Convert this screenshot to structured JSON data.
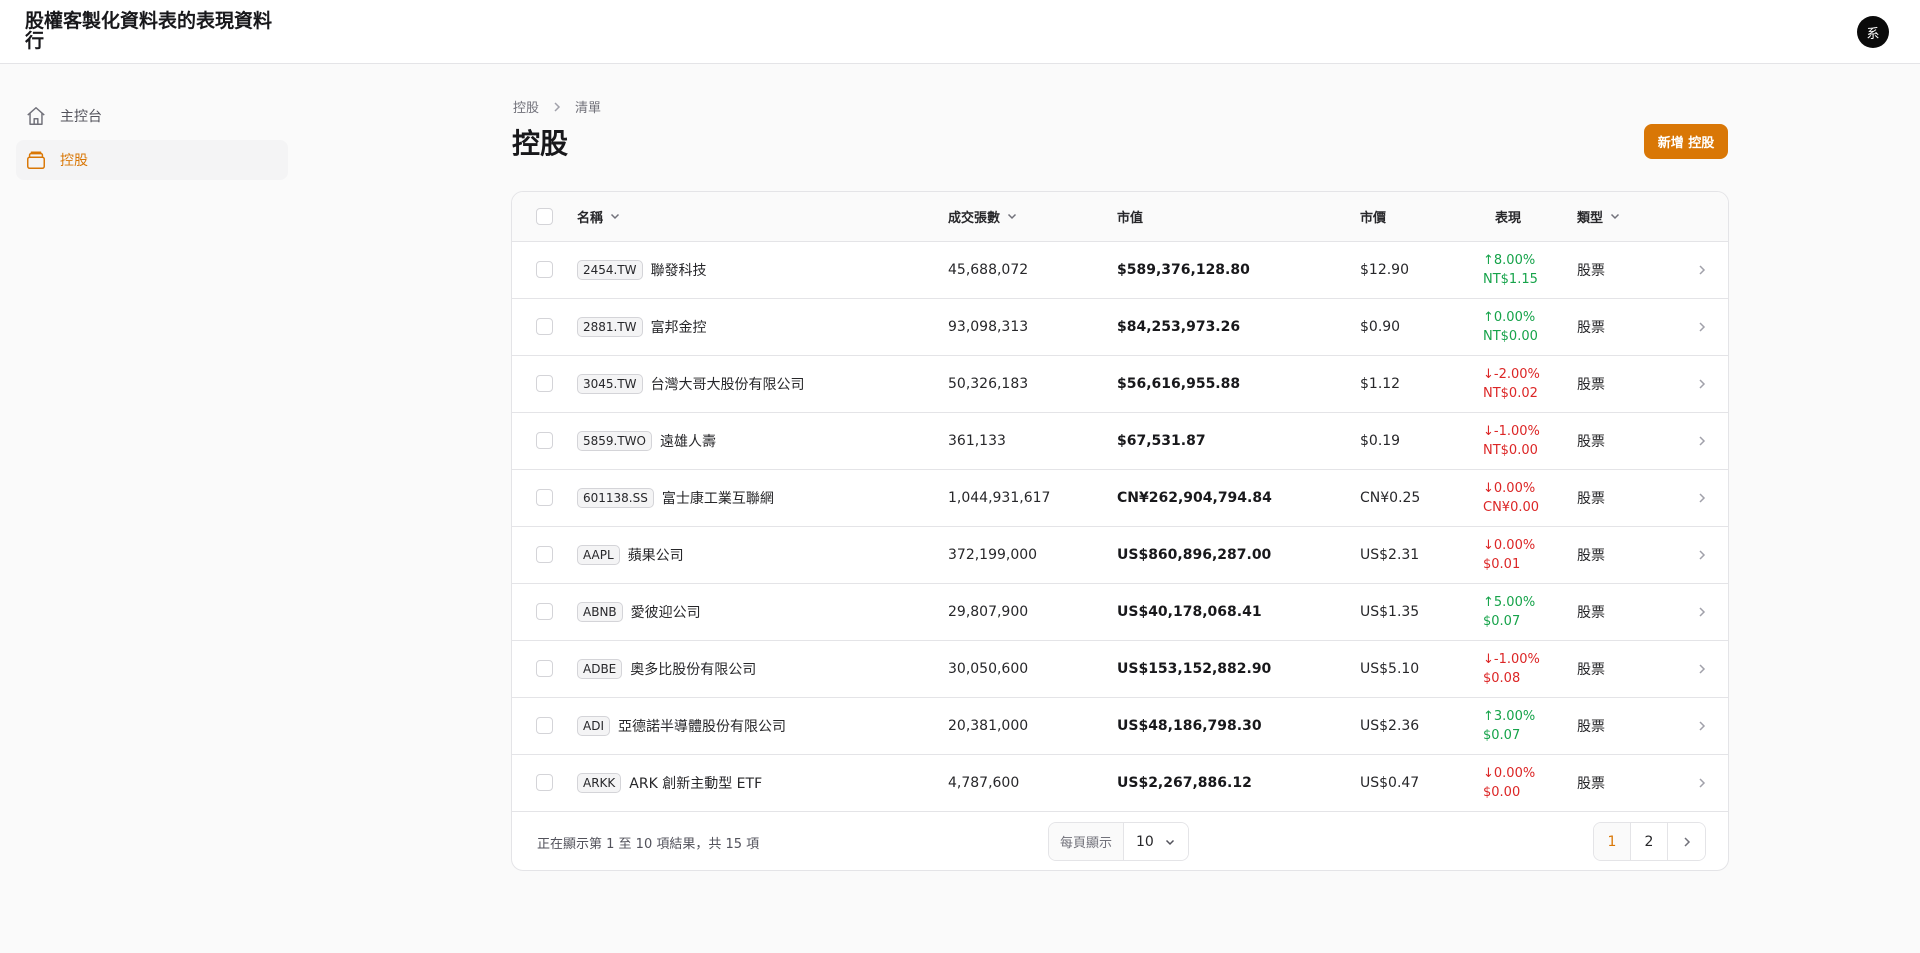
{
  "app": {
    "title": "股權客製化資料表的表現資料行",
    "avatar_initial": "系"
  },
  "sidebar": {
    "items": [
      {
        "label": "主控台",
        "icon": "home-icon",
        "active": false
      },
      {
        "label": "控股",
        "icon": "holdings-icon",
        "active": true
      }
    ]
  },
  "breadcrumb": {
    "parent": "控股",
    "current": "清單"
  },
  "page": {
    "title": "控股",
    "new_button": "新增 控股"
  },
  "table": {
    "columns": {
      "name": "名稱",
      "volume": "成交張數",
      "market_value": "市值",
      "price": "市價",
      "performance": "表現",
      "type": "類型"
    },
    "rows": [
      {
        "symbol": "2454.TW",
        "name": "聯發科技",
        "volume": "45,688,072",
        "market_value": "$589,376,128.80",
        "price": "$12.90",
        "perf_pct": "↑8.00%",
        "perf_amt": "NT$1.15",
        "trend": "up",
        "type": "股票"
      },
      {
        "symbol": "2881.TW",
        "name": "富邦金控",
        "volume": "93,098,313",
        "market_value": "$84,253,973.26",
        "price": "$0.90",
        "perf_pct": "↑0.00%",
        "perf_amt": "NT$0.00",
        "trend": "up",
        "type": "股票"
      },
      {
        "symbol": "3045.TW",
        "name": "台灣大哥大股份有限公司",
        "volume": "50,326,183",
        "market_value": "$56,616,955.88",
        "price": "$1.12",
        "perf_pct": "↓-2.00%",
        "perf_amt": "NT$0.02",
        "trend": "down",
        "type": "股票"
      },
      {
        "symbol": "5859.TWO",
        "name": "遠雄人壽",
        "volume": "361,133",
        "market_value": "$67,531.87",
        "price": "$0.19",
        "perf_pct": "↓-1.00%",
        "perf_amt": "NT$0.00",
        "trend": "down",
        "type": "股票"
      },
      {
        "symbol": "601138.SS",
        "name": "富士康工業互聯網",
        "volume": "1,044,931,617",
        "market_value": "CN¥262,904,794.84",
        "price": "CN¥0.25",
        "perf_pct": "↓0.00%",
        "perf_amt": "CN¥0.00",
        "trend": "down",
        "type": "股票"
      },
      {
        "symbol": "AAPL",
        "name": "蘋果公司",
        "volume": "372,199,000",
        "market_value": "US$860,896,287.00",
        "price": "US$2.31",
        "perf_pct": "↓0.00%",
        "perf_amt": "$0.01",
        "trend": "down",
        "type": "股票"
      },
      {
        "symbol": "ABNB",
        "name": "愛彼迎公司",
        "volume": "29,807,900",
        "market_value": "US$40,178,068.41",
        "price": "US$1.35",
        "perf_pct": "↑5.00%",
        "perf_amt": "$0.07",
        "trend": "up",
        "type": "股票"
      },
      {
        "symbol": "ADBE",
        "name": "奧多比股份有限公司",
        "volume": "30,050,600",
        "market_value": "US$153,152,882.90",
        "price": "US$5.10",
        "perf_pct": "↓-1.00%",
        "perf_amt": "$0.08",
        "trend": "down",
        "type": "股票"
      },
      {
        "symbol": "ADI",
        "name": "亞德諾半導體股份有限公司",
        "volume": "20,381,000",
        "market_value": "US$48,186,798.30",
        "price": "US$2.36",
        "perf_pct": "↑3.00%",
        "perf_amt": "$0.07",
        "trend": "up",
        "type": "股票"
      },
      {
        "symbol": "ARKK",
        "name": "ARK 創新主動型 ETF",
        "volume": "4,787,600",
        "market_value": "US$2,267,886.12",
        "price": "US$0.47",
        "perf_pct": "↓0.00%",
        "perf_amt": "$0.00",
        "trend": "down",
        "type": "股票"
      }
    ]
  },
  "footer": {
    "summary": "正在顯示第 1 至 10 項結果，共 15 項",
    "per_page_label": "每頁顯示",
    "per_page_value": "10",
    "pages": [
      "1",
      "2"
    ],
    "current_page": "1"
  },
  "colors": {
    "accent": "#d97706",
    "up": "#16a34a",
    "down": "#dc2626"
  }
}
